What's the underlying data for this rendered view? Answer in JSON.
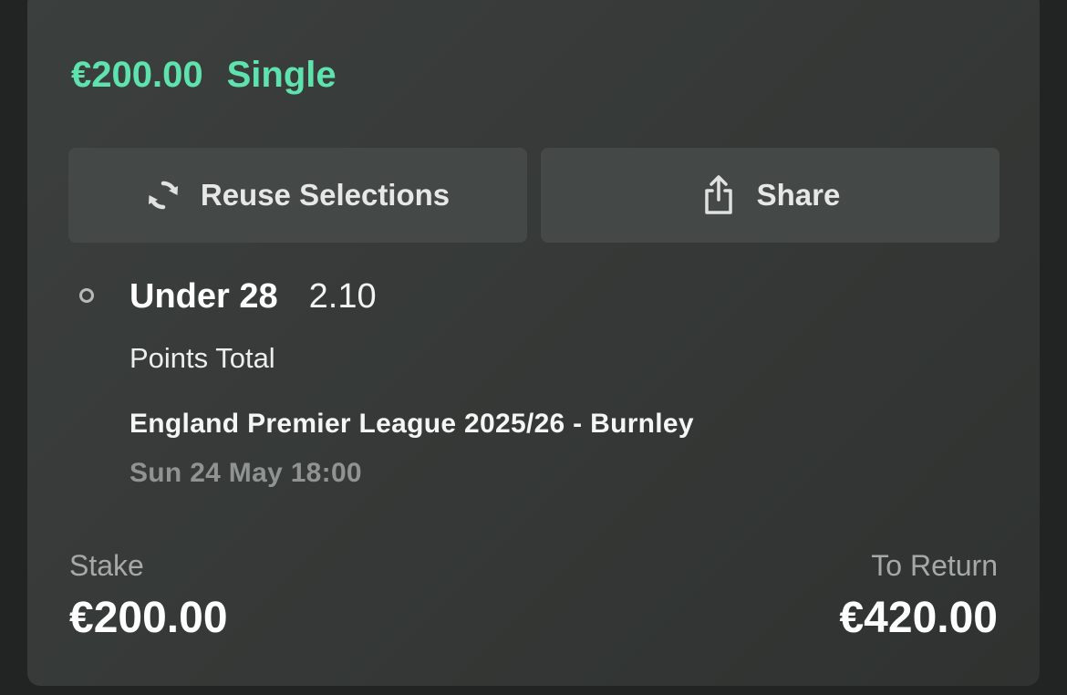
{
  "bet": {
    "amount": "€200.00",
    "type": "Single"
  },
  "actions": {
    "reuse_label": "Reuse Selections",
    "reuse_icon": "refresh-icon",
    "share_label": "Share",
    "share_icon": "share-icon"
  },
  "selection": {
    "name": "Under 28",
    "odds": "2.10",
    "market": "Points Total",
    "event": "England Premier League 2025/26 - Burnley",
    "datetime": "Sun 24 May 18:00",
    "status_icon": "pending-circle-icon"
  },
  "summary": {
    "stake_label": "Stake",
    "stake_value": "€200.00",
    "return_label": "To Return",
    "return_value": "€420.00"
  },
  "colors": {
    "accent": "#5fe3ae",
    "card_background": "#373a38",
    "button_background": "#444846",
    "muted_text": "#8f9391"
  }
}
